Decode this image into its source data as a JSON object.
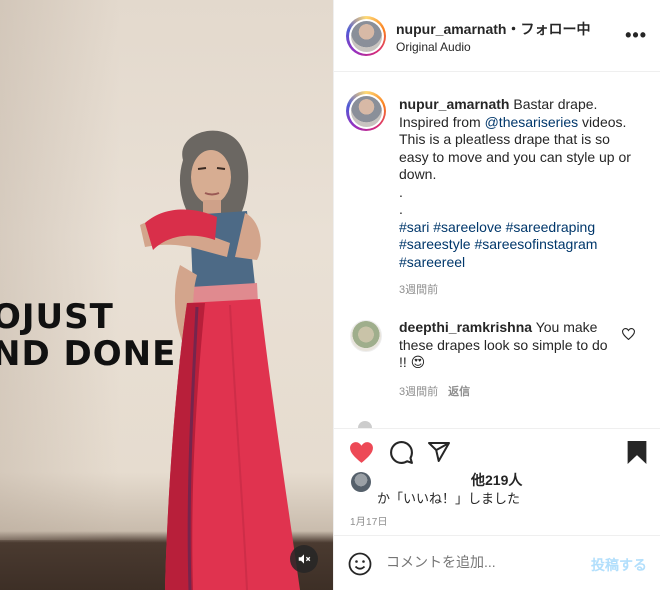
{
  "media": {
    "overlay_line1": "OJUST",
    "overlay_line2": "ND DONE.",
    "mute_icon": "speaker-muted-icon"
  },
  "header": {
    "username": "nupur_amarnath",
    "separator": "・",
    "follow_label": "フォロー中",
    "audio_label": "Original Audio",
    "more_icon": "more-horizontal-icon"
  },
  "caption": {
    "username": "nupur_amarnath",
    "text_start": " Bastar drape. Inspired from ",
    "mention": "@thesariseries",
    "text_end": " videos. This is a pleatless drape that is so easy to move and you can style up or down.",
    "dot1": ".",
    "dot2": ".",
    "hashtags_line1": "#sari #sareelove #sareedraping",
    "hashtags_line2": "#sareestyle #sareesofinstagram",
    "hashtags_line3": "#sareereel",
    "time": "3週間前"
  },
  "comment": {
    "username": "deepthi_ramkrishna",
    "text": " You make these drapes look so simple to do !! 😍",
    "time": "3週間前",
    "reply_label": "返信"
  },
  "actions": {
    "like_icon": "heart-filled-icon",
    "comment_icon": "comment-icon",
    "share_icon": "share-icon",
    "save_icon": "bookmark-filled-icon",
    "like_color": "#ed4956"
  },
  "likes": {
    "count_text": "他219人",
    "liked_text": "か「いいね！」しました"
  },
  "date": "1月17日",
  "add_comment": {
    "placeholder": "コメントを追加...",
    "post_label": "投稿する",
    "emoji_icon": "emoji-smile-icon"
  }
}
